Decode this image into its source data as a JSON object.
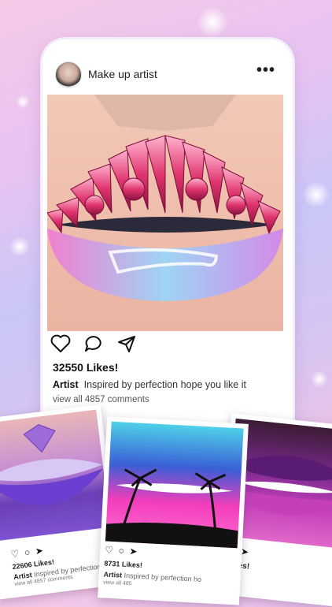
{
  "post": {
    "username": "Make up artist",
    "more_icon": "more-icon",
    "likes": "32550 Likes!",
    "caption_author": "Artist",
    "caption_text": "Inspired by perfection hope you like it",
    "comments": "view all 4857 comments"
  },
  "cards": {
    "left": {
      "likes": "22606 Likes!",
      "caption_author": "Artist",
      "caption_text": "Inspired by perfection ho",
      "comments": "view all 4857 comments"
    },
    "middle": {
      "likes": "8731 Likes!",
      "caption_author": "Artist",
      "caption_text": "Inspired by perfection ho",
      "comments": "view all 485"
    },
    "right": {
      "likes": "Likes!"
    }
  },
  "colors": {
    "accent": "#ff4f9a",
    "text": "#222222"
  }
}
